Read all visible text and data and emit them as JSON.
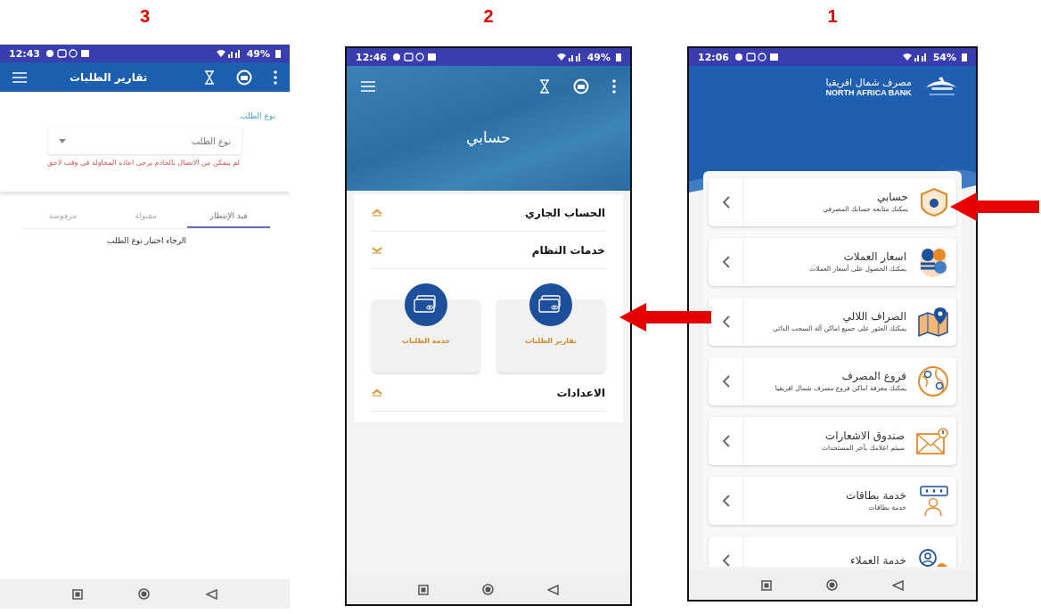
{
  "panels": [
    {
      "kind": "home",
      "number": "1",
      "status_bar": {
        "time": "12:06",
        "battery": "54%"
      },
      "brand": {
        "name_ar": "مصرف شمال افريقيا",
        "name_en": "NORTH AFRICA BANK"
      },
      "items": [
        {
          "title": "حسابي",
          "subtitle": "يمكنك متابعه حسابك المصرفي"
        },
        {
          "title": "اسعار العملات",
          "subtitle": "يمكنك الحصول على أسعار العملات"
        },
        {
          "title": "الصراف اللالي",
          "subtitle": "يمكنك العثور على جميع اماكن آلة السحب الذاتي"
        },
        {
          "title": "فروع المصرف",
          "subtitle": "يمكنك معرفة اماكن فروع مصرف شمال افريقيا"
        },
        {
          "title": "صندوق الاشعارات",
          "subtitle": "سيتم اعلامك بآخر المستجدات"
        },
        {
          "title": "خدمة بطاقات",
          "subtitle": "خدمة بطاقات"
        },
        {
          "title": "خدمة العملاء"
        }
      ]
    },
    {
      "kind": "account",
      "number": "2",
      "status_bar": {
        "time": "12:46",
        "battery": "49%"
      },
      "header": {
        "title": "حسابي"
      },
      "sections": [
        {
          "title": "الحساب الجاري",
          "expanded": false
        },
        {
          "title": "خدمات النظام",
          "expanded": true,
          "tiles": [
            {
              "label": "تقارير الطلبات"
            },
            {
              "label": "خدمة الطلبات"
            }
          ]
        },
        {
          "title": "الاعدادات",
          "expanded": false
        }
      ]
    },
    {
      "kind": "requests",
      "number": "3",
      "status_bar": {
        "time": "12:43",
        "battery": "49%"
      },
      "app_bar": {
        "title": "تقارير الطلبات"
      },
      "form": {
        "label": "نوع الطلب",
        "select_placeholder": "نوع الطلب",
        "error": "لم يتمكن من الاتصال بالخادم يرجى اعادة المحاولة في وقت لاحق"
      },
      "tabs": [
        {
          "label": "قيد الإنتظار",
          "selected": true
        },
        {
          "label": "مقبولة",
          "selected": false
        },
        {
          "label": "مرفوضة",
          "selected": false
        }
      ],
      "message": "الرجاء اختيار نوع الطلب"
    }
  ]
}
